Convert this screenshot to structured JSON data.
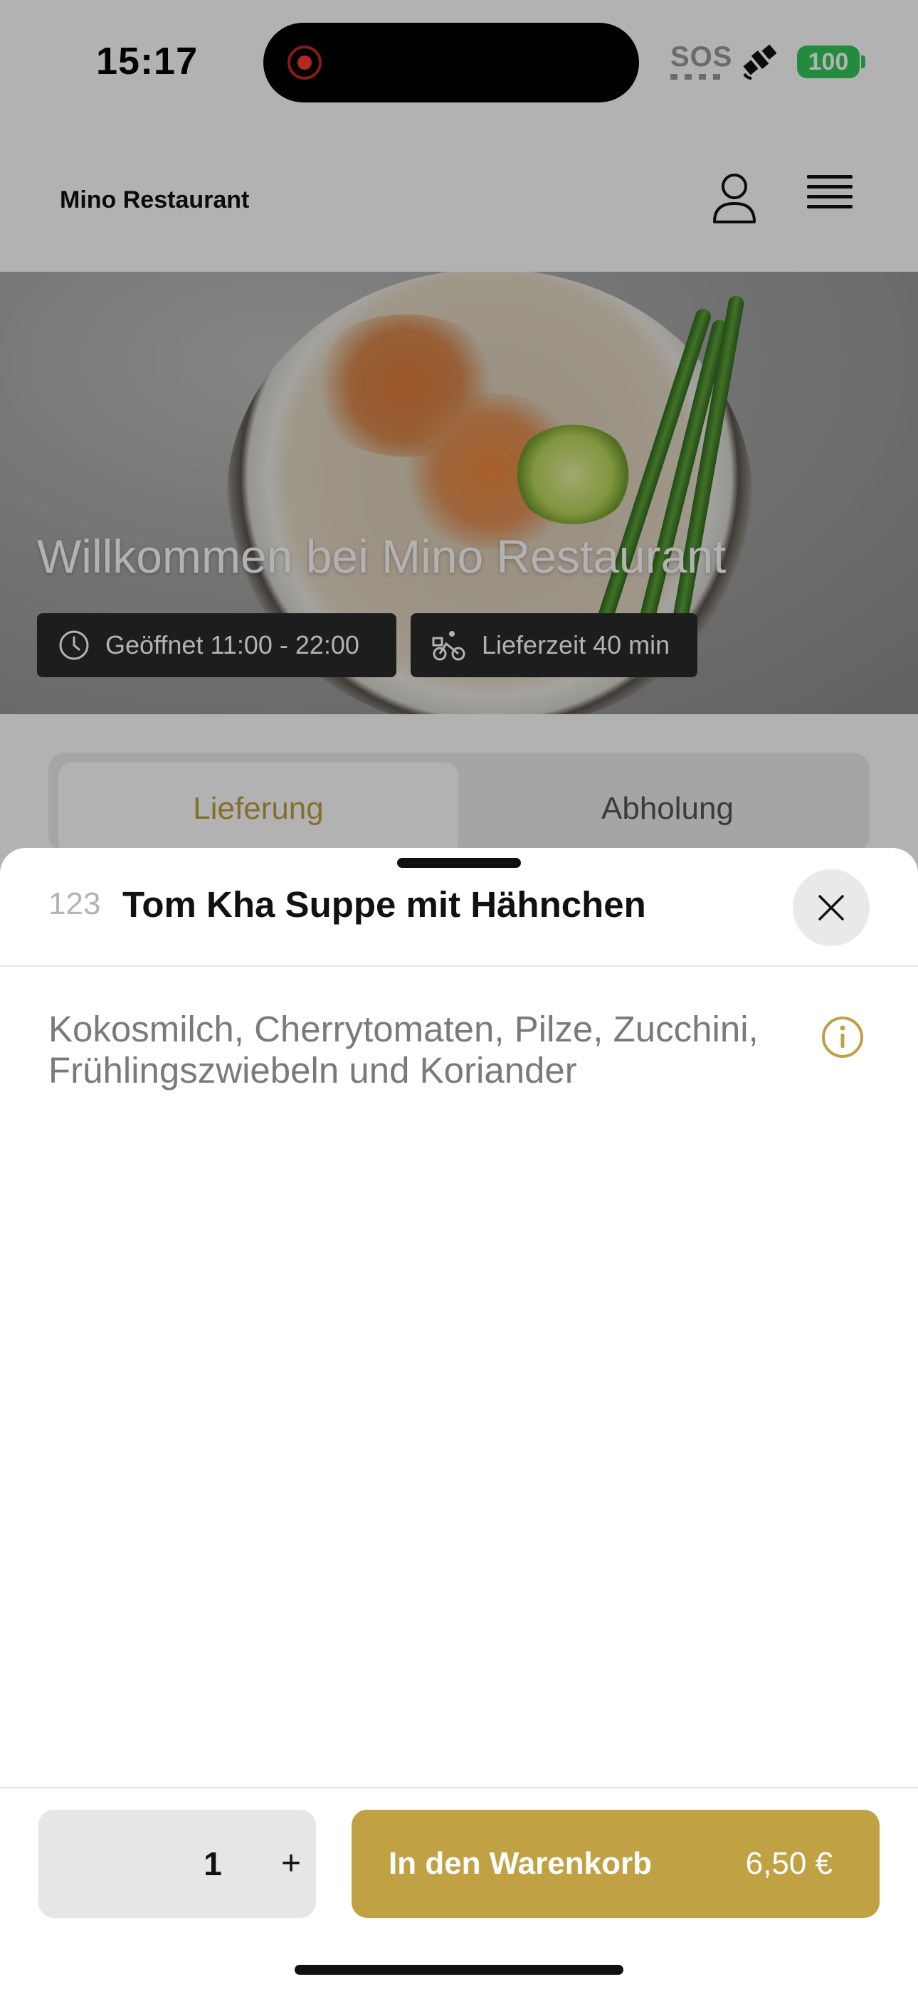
{
  "status_bar": {
    "time": "15:17",
    "sos": "SOS",
    "battery": "100",
    "battery_color": "#34c759",
    "recording_color": "#ff3b30"
  },
  "header": {
    "brand": "Mino Restaurant",
    "icons": [
      "user-icon",
      "hamburger-menu-icon"
    ]
  },
  "hero": {
    "title": "Willkommen bei Mino Restaurant",
    "opening_hours": "Geöffnet 11:00 - 22:00",
    "delivery_time": "Lieferzeit 40 min",
    "icons": [
      "clock-icon",
      "bike-delivery-icon"
    ]
  },
  "order_tabs": {
    "items": [
      "Lieferung",
      "Abholung"
    ],
    "selected": "Lieferung"
  },
  "sheet": {
    "item_number": "123",
    "item_title": "Tom Kha Suppe mit Hähnchen",
    "description": "Kokosmilch, Cherrytomaten, Pilze, Zucchini, Frühlingszwiebeln und Koriander",
    "icons": [
      "close-icon",
      "info-icon"
    ]
  },
  "footer": {
    "quantity": "1",
    "plus": "+",
    "add_to_cart": "In den Warenkorb",
    "price": "6,50 €"
  },
  "colors": {
    "accent": "#c0a143",
    "accent_text": "#bfa043"
  }
}
